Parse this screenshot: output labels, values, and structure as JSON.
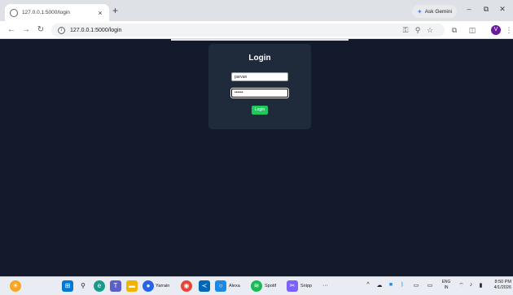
{
  "browser": {
    "tab_title": "127.0.0.1:5000/login",
    "tab_close": "×",
    "new_tab": "+",
    "ask_gemini": "Ask Gemini",
    "minimize": "–",
    "restore": "⧉",
    "close": "✕",
    "back": "←",
    "forward": "→",
    "reload": "↻",
    "url": "127.0.0.1:5000/login",
    "profile_initial": "V"
  },
  "page": {
    "login_title": "Login",
    "username_value": "parvan",
    "password_value": "••••••",
    "login_button": "Login"
  },
  "taskbar": {
    "yarrain_label": "Yarrain",
    "alexa_label": "Alexa",
    "spotify_label": "Spotif",
    "snipping_label": "Snipp",
    "more": "···",
    "lang_top": "ENG",
    "lang_bottom": "IN",
    "time": "8:50 PM",
    "date": "4/1/2026"
  },
  "colors": {
    "page_bg": "#121a2b",
    "card_bg": "#1f2a3b",
    "button": "#22c55e",
    "profile": "#6a1b9a"
  }
}
